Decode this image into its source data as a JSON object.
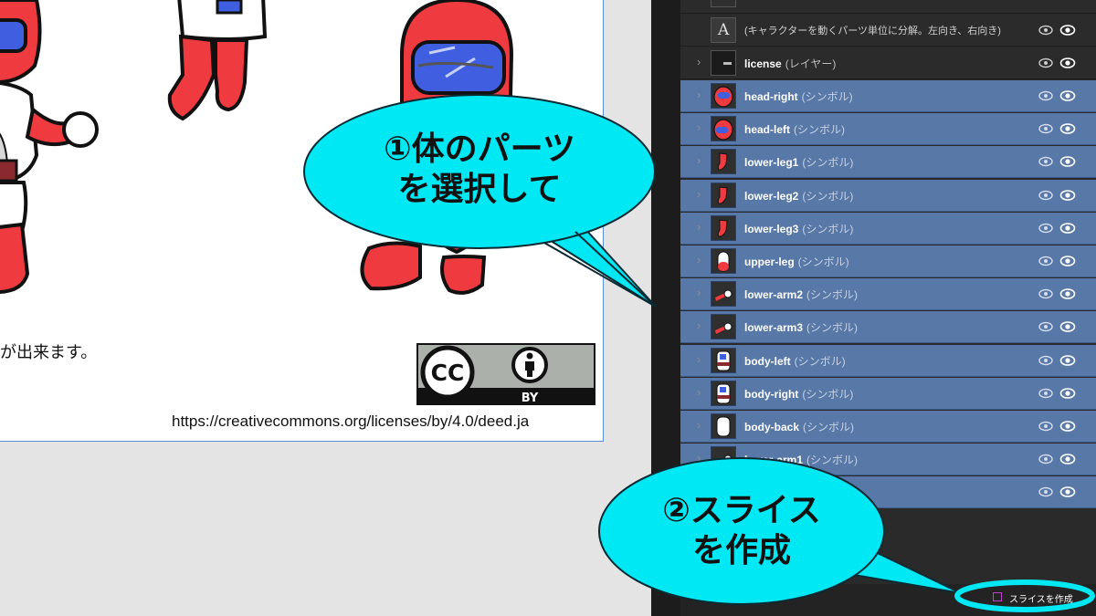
{
  "artboard": {
    "note": "が出来ます。",
    "license_url": "https://creativecommons.org/licenses/by/4.0/deed.ja",
    "cc_badge": {
      "cc": "CC",
      "by": "BY"
    }
  },
  "layers": {
    "text_row": {
      "glyph": "A",
      "text": "(キャラクターを動くパーツ単位に分解。左向き、右向き)"
    },
    "license_row": {
      "name": "license",
      "kind": "(レイヤー)"
    },
    "symbols": [
      {
        "name": "head-right",
        "kind": "(シンボル)",
        "thumb": "head-right-icon"
      },
      {
        "name": "head-left",
        "kind": "(シンボル)",
        "thumb": "head-left-icon"
      },
      {
        "name": "lower-leg1",
        "kind": "(シンボル)",
        "thumb": "leg-icon"
      },
      {
        "name": "lower-leg2",
        "kind": "(シンボル)",
        "thumb": "leg-icon"
      },
      {
        "name": "lower-leg3",
        "kind": "(シンボル)",
        "thumb": "leg-icon"
      },
      {
        "name": "upper-leg",
        "kind": "(シンボル)",
        "thumb": "upper-leg-icon"
      },
      {
        "name": "lower-arm2",
        "kind": "(シンボル)",
        "thumb": "arm-icon"
      },
      {
        "name": "lower-arm3",
        "kind": "(シンボル)",
        "thumb": "arm-icon"
      },
      {
        "name": "body-left",
        "kind": "(シンボル)",
        "thumb": "body-icon"
      },
      {
        "name": "body-right",
        "kind": "(シンボル)",
        "thumb": "body-icon"
      },
      {
        "name": "body-back",
        "kind": "(シンボル)",
        "thumb": "body-back-icon"
      },
      {
        "name": "lower-arm1",
        "kind": "(シンボル)",
        "thumb": "arm-icon"
      }
    ],
    "slice_button": "スライスを作成"
  },
  "callouts": {
    "first": [
      "①体のパーツ",
      "を選択して"
    ],
    "second": [
      "②スライス",
      "を作成"
    ]
  },
  "colors": {
    "selection": "#5878a8",
    "callout": "#00e8f4",
    "character_red": "#ef3a3f"
  }
}
